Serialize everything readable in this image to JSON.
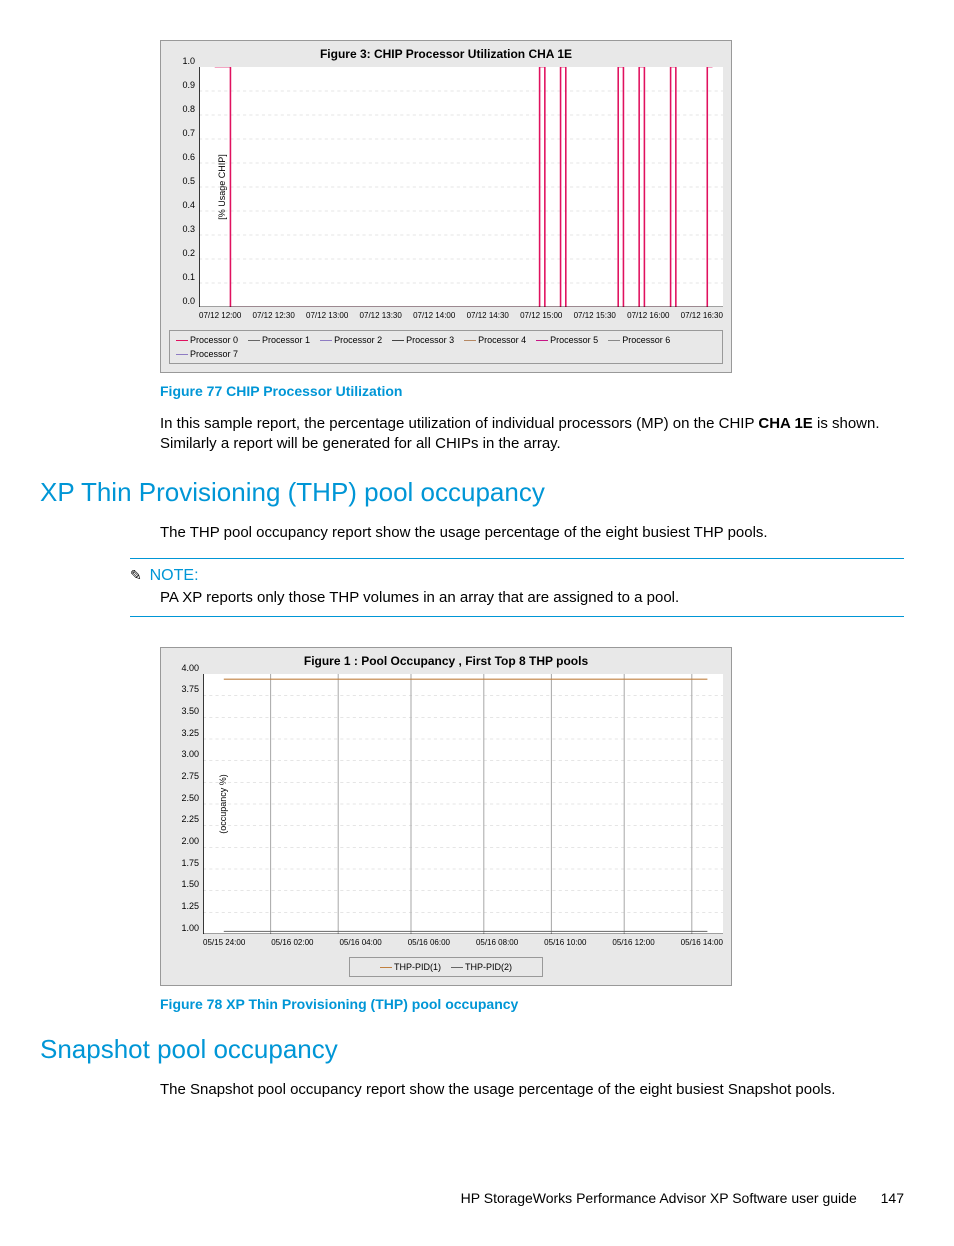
{
  "chart_data": [
    {
      "type": "line",
      "title": "Figure 3: CHIP Processor Utilization CHA 1E",
      "ylabel": "[% Usage CHIP]",
      "xlabel": "",
      "ylim": [
        0.0,
        1.0
      ],
      "y_ticks": [
        "0.0",
        "0.1",
        "0.2",
        "0.3",
        "0.4",
        "0.5",
        "0.6",
        "0.7",
        "0.8",
        "0.9",
        "1.0"
      ],
      "x_ticks": [
        "07/12 12:00",
        "07/12 12:30",
        "07/12 13:00",
        "07/12 13:30",
        "07/12 14:00",
        "07/12 14:30",
        "07/12 15:00",
        "07/12 15:30",
        "07/12 16:00",
        "07/12 16:30"
      ],
      "series": [
        {
          "name": "Processor 0",
          "color": "#e0115f",
          "values": [
            1.0,
            0,
            0,
            0,
            0,
            0,
            0,
            0,
            0,
            0,
            0,
            0,
            0,
            0,
            0,
            0,
            0,
            0
          ]
        },
        {
          "name": "Processor 1",
          "color": "#666",
          "values": []
        },
        {
          "name": "Processor 2",
          "color": "#8e7cc3",
          "values": []
        },
        {
          "name": "Processor 3",
          "color": "#444",
          "values": []
        },
        {
          "name": "Processor 4",
          "color": "#b58863",
          "values": []
        },
        {
          "name": "Processor 5",
          "color": "#c71585",
          "values": [
            0,
            0,
            0,
            0,
            0,
            0,
            0,
            0,
            0,
            0,
            0,
            0,
            1.0,
            1.0,
            0,
            1.0,
            1.0,
            1.0
          ]
        },
        {
          "name": "Processor 6",
          "color": "#888",
          "values": []
        },
        {
          "name": "Processor 7",
          "color": "#8e7cc3",
          "values": []
        }
      ]
    },
    {
      "type": "line",
      "title": "Figure 1 : Pool Occupancy , First Top 8 THP pools",
      "ylabel": "(occupancy %)",
      "xlabel": "",
      "ylim": [
        1.0,
        4.0
      ],
      "y_ticks": [
        "1.00",
        "1.25",
        "1.50",
        "1.75",
        "2.00",
        "2.25",
        "2.50",
        "2.75",
        "3.00",
        "3.25",
        "3.50",
        "3.75",
        "4.00"
      ],
      "x_ticks": [
        "05/15 24:00",
        "05/16 02:00",
        "05/16 04:00",
        "05/16 06:00",
        "05/16 08:00",
        "05/16 10:00",
        "05/16 12:00",
        "05/16 14:00"
      ],
      "series": [
        {
          "name": "THP-PID(1)",
          "color": "#c08040",
          "values": [
            4.0,
            4.0,
            4.0,
            4.0,
            4.0,
            4.0,
            4.0,
            4.0
          ]
        },
        {
          "name": "THP-PID(2)",
          "color": "#666",
          "values": [
            1.0,
            1.0,
            1.0,
            1.0,
            1.0,
            1.0,
            1.0,
            1.0
          ]
        }
      ]
    }
  ],
  "fig77_caption": "Figure 77 CHIP Processor Utilization",
  "fig77_para_a": "In this sample report, the percentage utilization of individual processors (MP) on the CHIP ",
  "fig77_bold": "CHA 1E",
  "fig77_para_b": " is shown. Similarly a report will be generated for all CHIPs in the array.",
  "section_thp": "XP Thin Provisioning (THP) pool occupancy",
  "thp_para": "The THP pool occupancy report show the usage percentage of the eight busiest THP pools.",
  "note_label": "NOTE:",
  "note_text": "PA XP reports only those THP volumes in an array that are assigned to a pool.",
  "fig78_caption": "Figure 78 XP Thin Provisioning (THP) pool occupancy",
  "section_snap": "Snapshot pool occupancy",
  "snap_para": "The Snapshot pool occupancy report show the usage percentage of the eight busiest Snapshot pools.",
  "footer_text": "HP StorageWorks Performance Advisor XP Software user guide",
  "page_number": "147"
}
